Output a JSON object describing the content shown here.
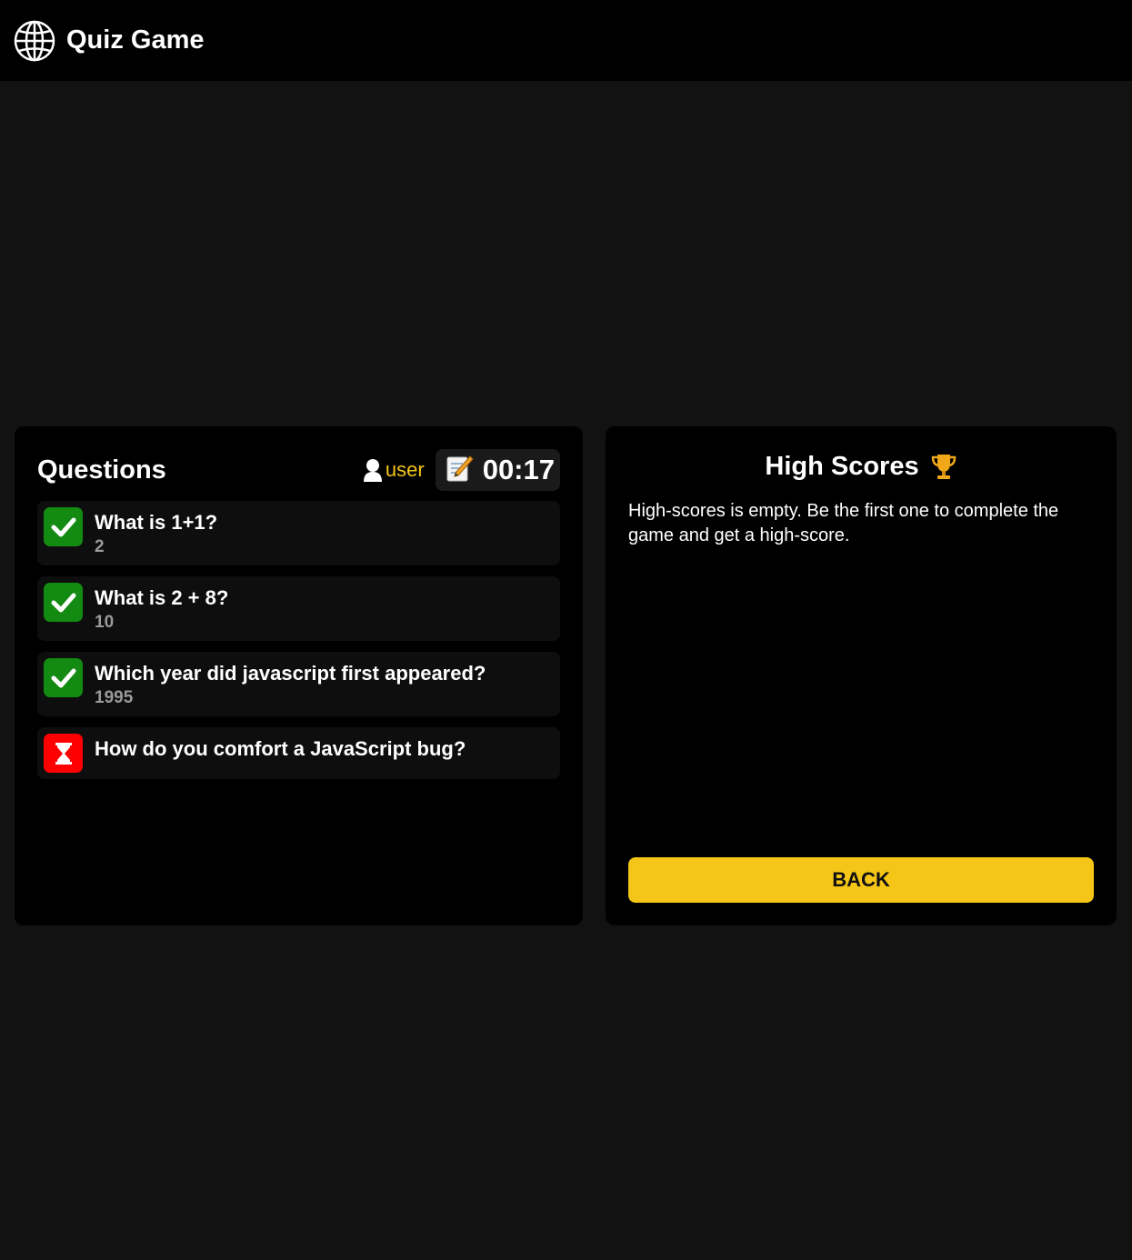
{
  "header": {
    "app_title": "Quiz Game",
    "logo_icon": "globe-icon"
  },
  "questions_panel": {
    "title": "Questions",
    "user": {
      "icon": "user-icon",
      "name": "user"
    },
    "timer": {
      "icon": "memo-icon",
      "value": "00:17"
    },
    "items": [
      {
        "status": "correct",
        "status_icon": "check-icon",
        "question": "What is 1+1?",
        "answer": "2"
      },
      {
        "status": "correct",
        "status_icon": "check-icon",
        "question": "What is 2 + 8?",
        "answer": "10"
      },
      {
        "status": "correct",
        "status_icon": "check-icon",
        "question": "Which year did javascript first appeared?",
        "answer": "1995"
      },
      {
        "status": "pending",
        "status_icon": "hourglass-icon",
        "question": "How do you comfort a JavaScript bug?",
        "answer": ""
      }
    ]
  },
  "high_scores_panel": {
    "title": "High Scores",
    "title_icon": "trophy-icon",
    "empty_message": "High-scores is empty. Be the first one to complete the game and get a high-score.",
    "back_label": "BACK"
  },
  "colors": {
    "accent": "#f5c518",
    "correct": "#138a12",
    "pending": "#ff0000",
    "panel_bg": "#000000",
    "page_bg": "#121212"
  }
}
